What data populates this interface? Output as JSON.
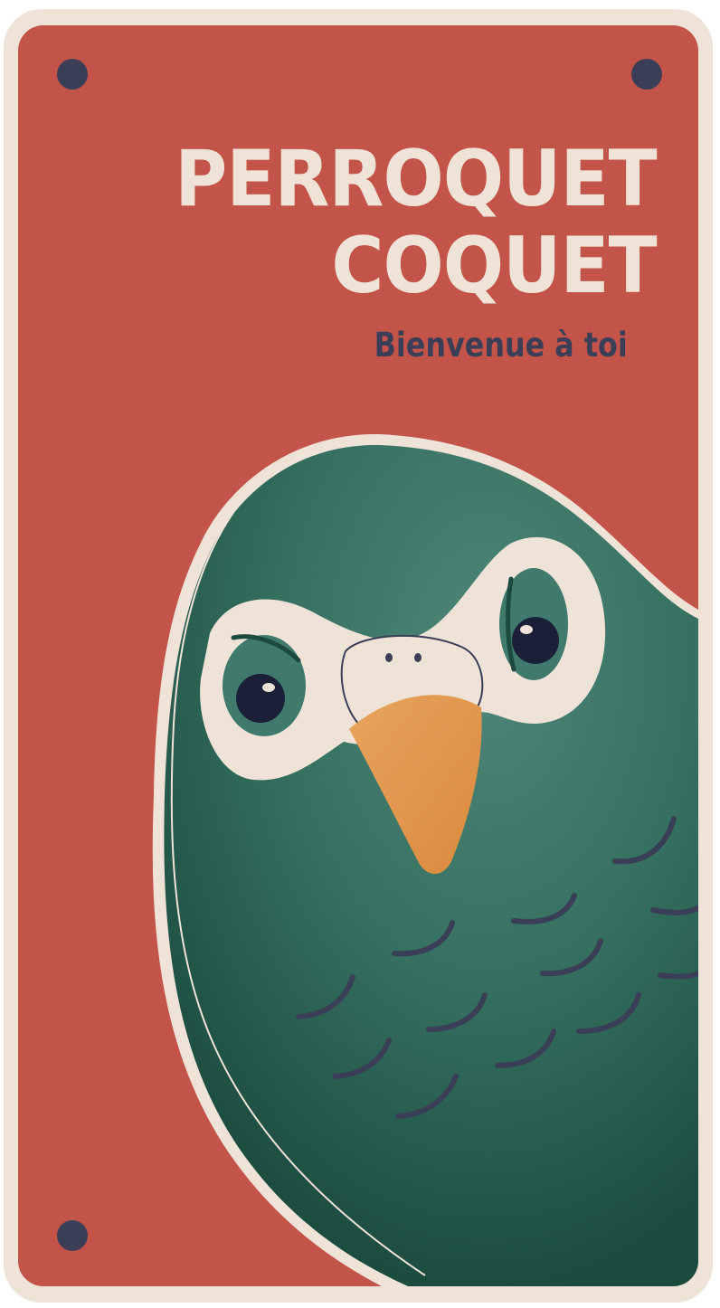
{
  "sign": {
    "title_line1": "PERROQUET",
    "title_line2": "COQUET",
    "subtitle": "Bienvenue à toi"
  },
  "illustration": {
    "subject": "parrot-icon"
  },
  "colors": {
    "frame": "#efe3d7",
    "background": "#c3544a",
    "screw": "#3a3f57",
    "feathers_dark": "#1d4a3f",
    "feathers_light": "#4a7f71",
    "beak": "#e39a4f",
    "eye": "#1c1f38",
    "text_dark": "#3a3f57"
  }
}
